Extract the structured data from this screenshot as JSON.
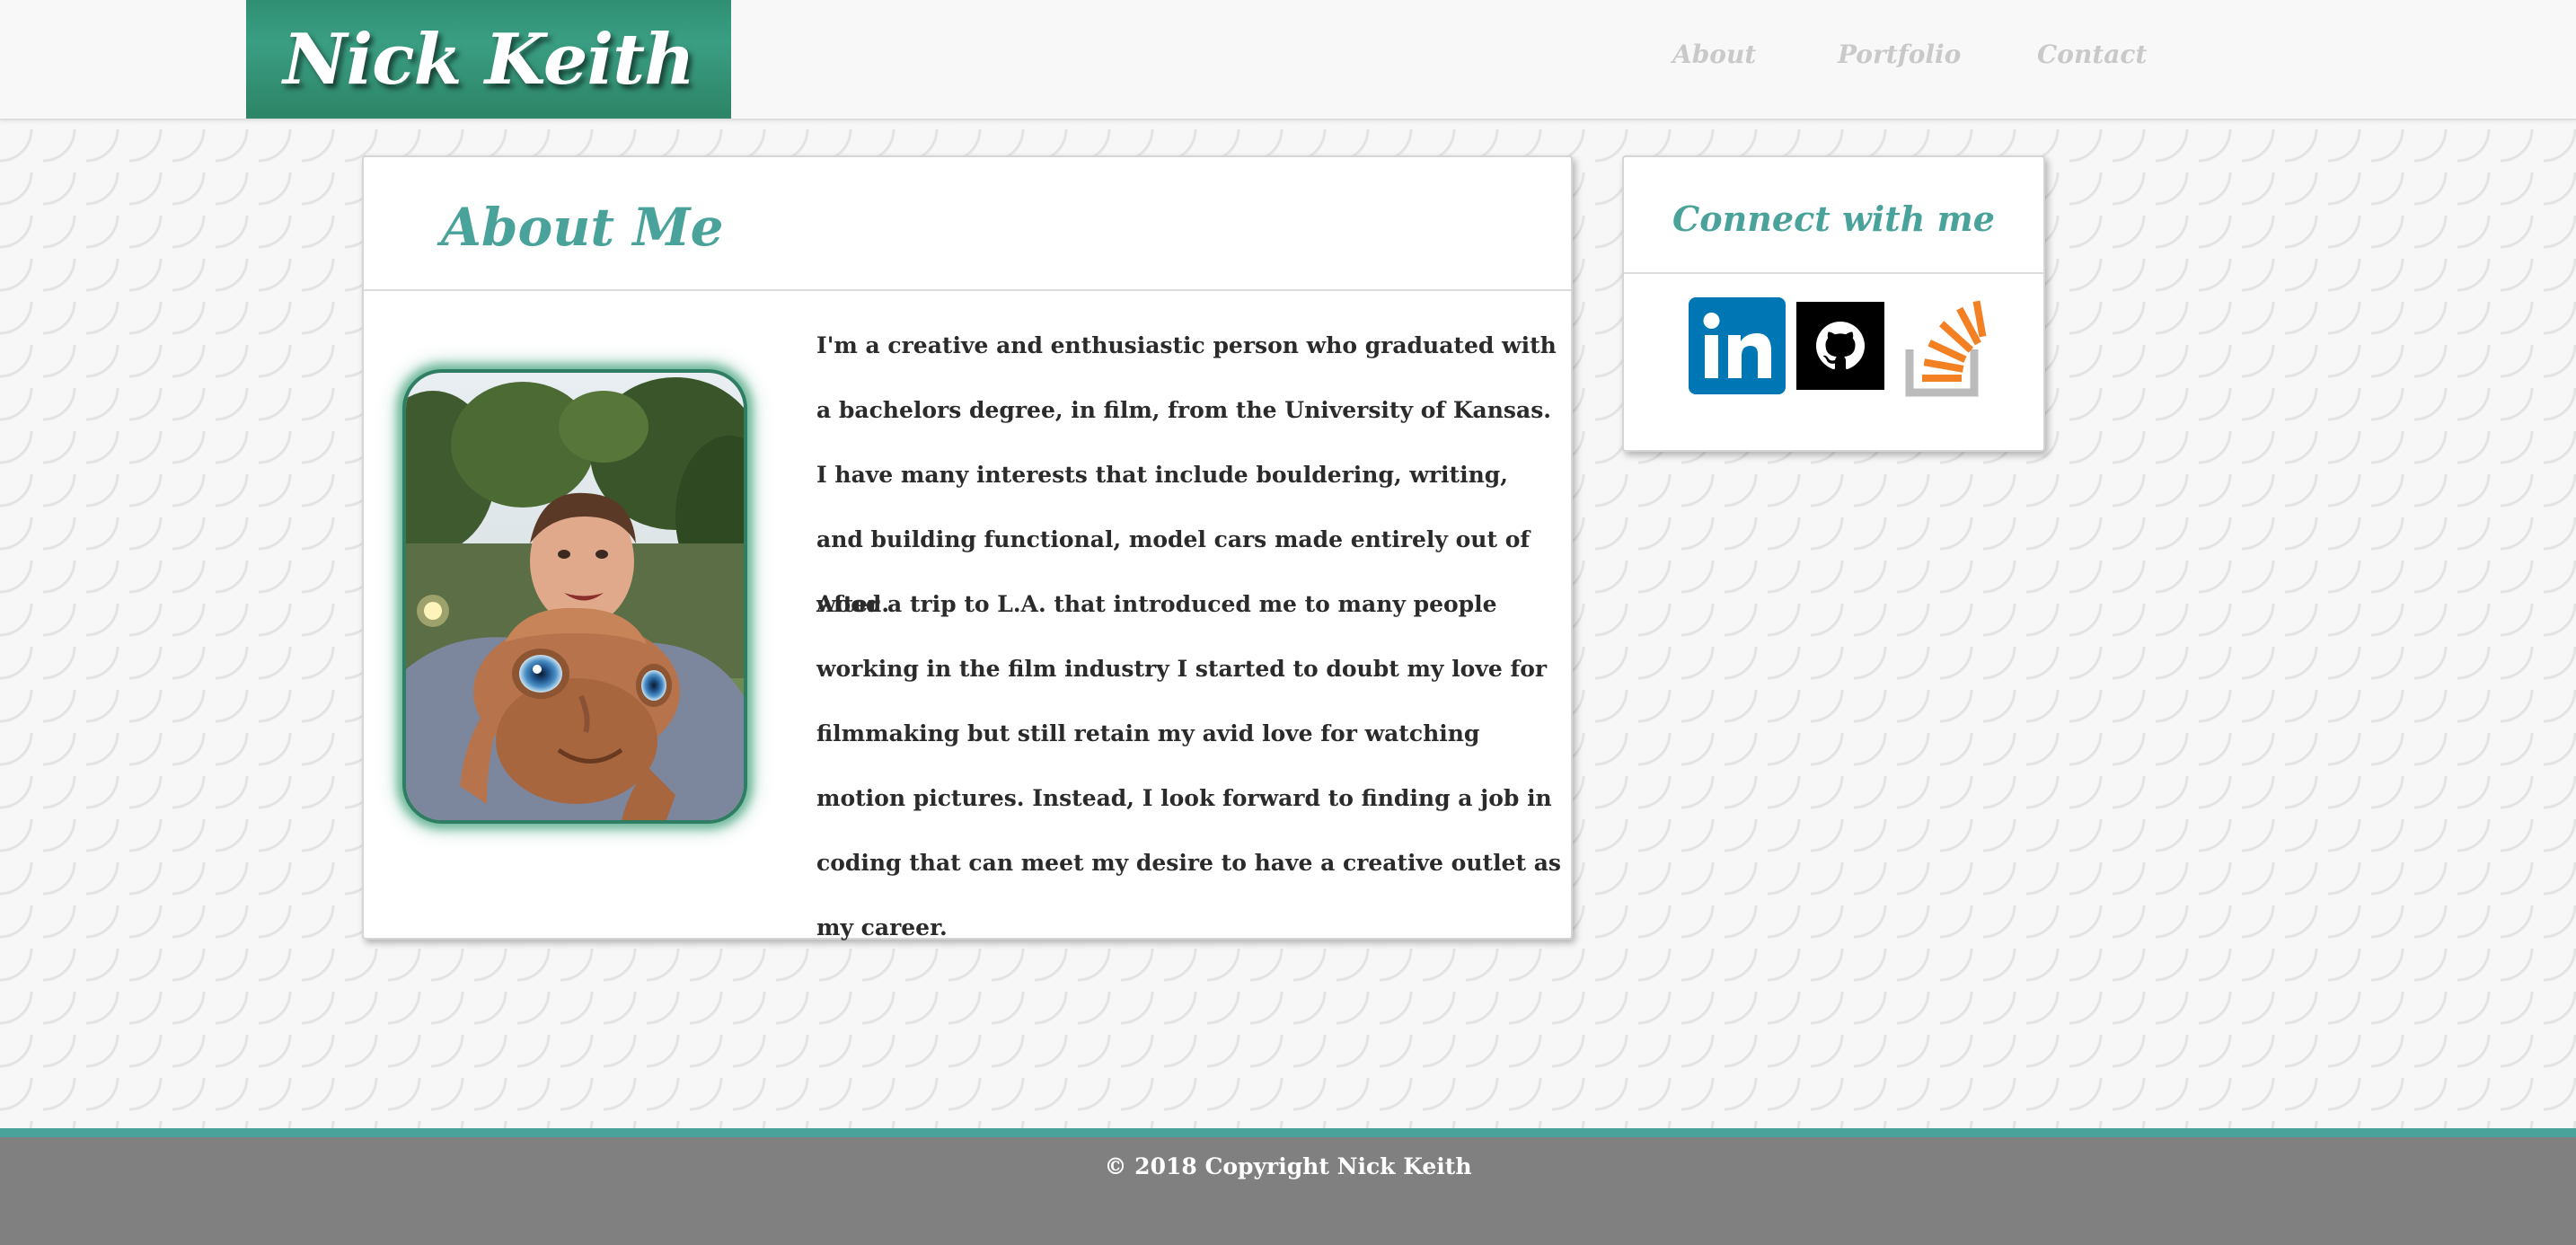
{
  "header": {
    "brand": "Nick Keith",
    "nav": [
      {
        "label": "About"
      },
      {
        "label": "Portfolio"
      },
      {
        "label": "Contact"
      }
    ]
  },
  "about": {
    "title": "About Me",
    "photo_alt": "Nick Keith holding an E.T. plush toy",
    "paragraphs": [
      "I'm a creative and enthusiastic person who graduated with a bachelors degree, in film, from the University of Kansas. I have many interests that include bouldering, writing, and building functional, model cars made entirely out of wood.",
      "After a trip to L.A. that introduced me to many people working in the film industry I started to doubt my love for filmmaking but still retain my avid love for watching motion pictures. Instead, I look forward to finding a job in coding that can meet my desire to have a creative outlet as my career."
    ]
  },
  "connect": {
    "title": "Connect with me",
    "links": [
      {
        "name": "LinkedIn",
        "icon": "linkedin-icon",
        "color": "#0077b5"
      },
      {
        "name": "GitHub",
        "icon": "github-icon",
        "color": "#000000"
      },
      {
        "name": "Stack Overflow",
        "icon": "stackoverflow-icon",
        "color": "#f48024"
      }
    ]
  },
  "footer": {
    "text": "© 2018 Copyright Nick Keith"
  },
  "colors": {
    "accent": "#4aa39a",
    "brand_bg": "#2f8f72",
    "footer_bg": "#808080"
  }
}
